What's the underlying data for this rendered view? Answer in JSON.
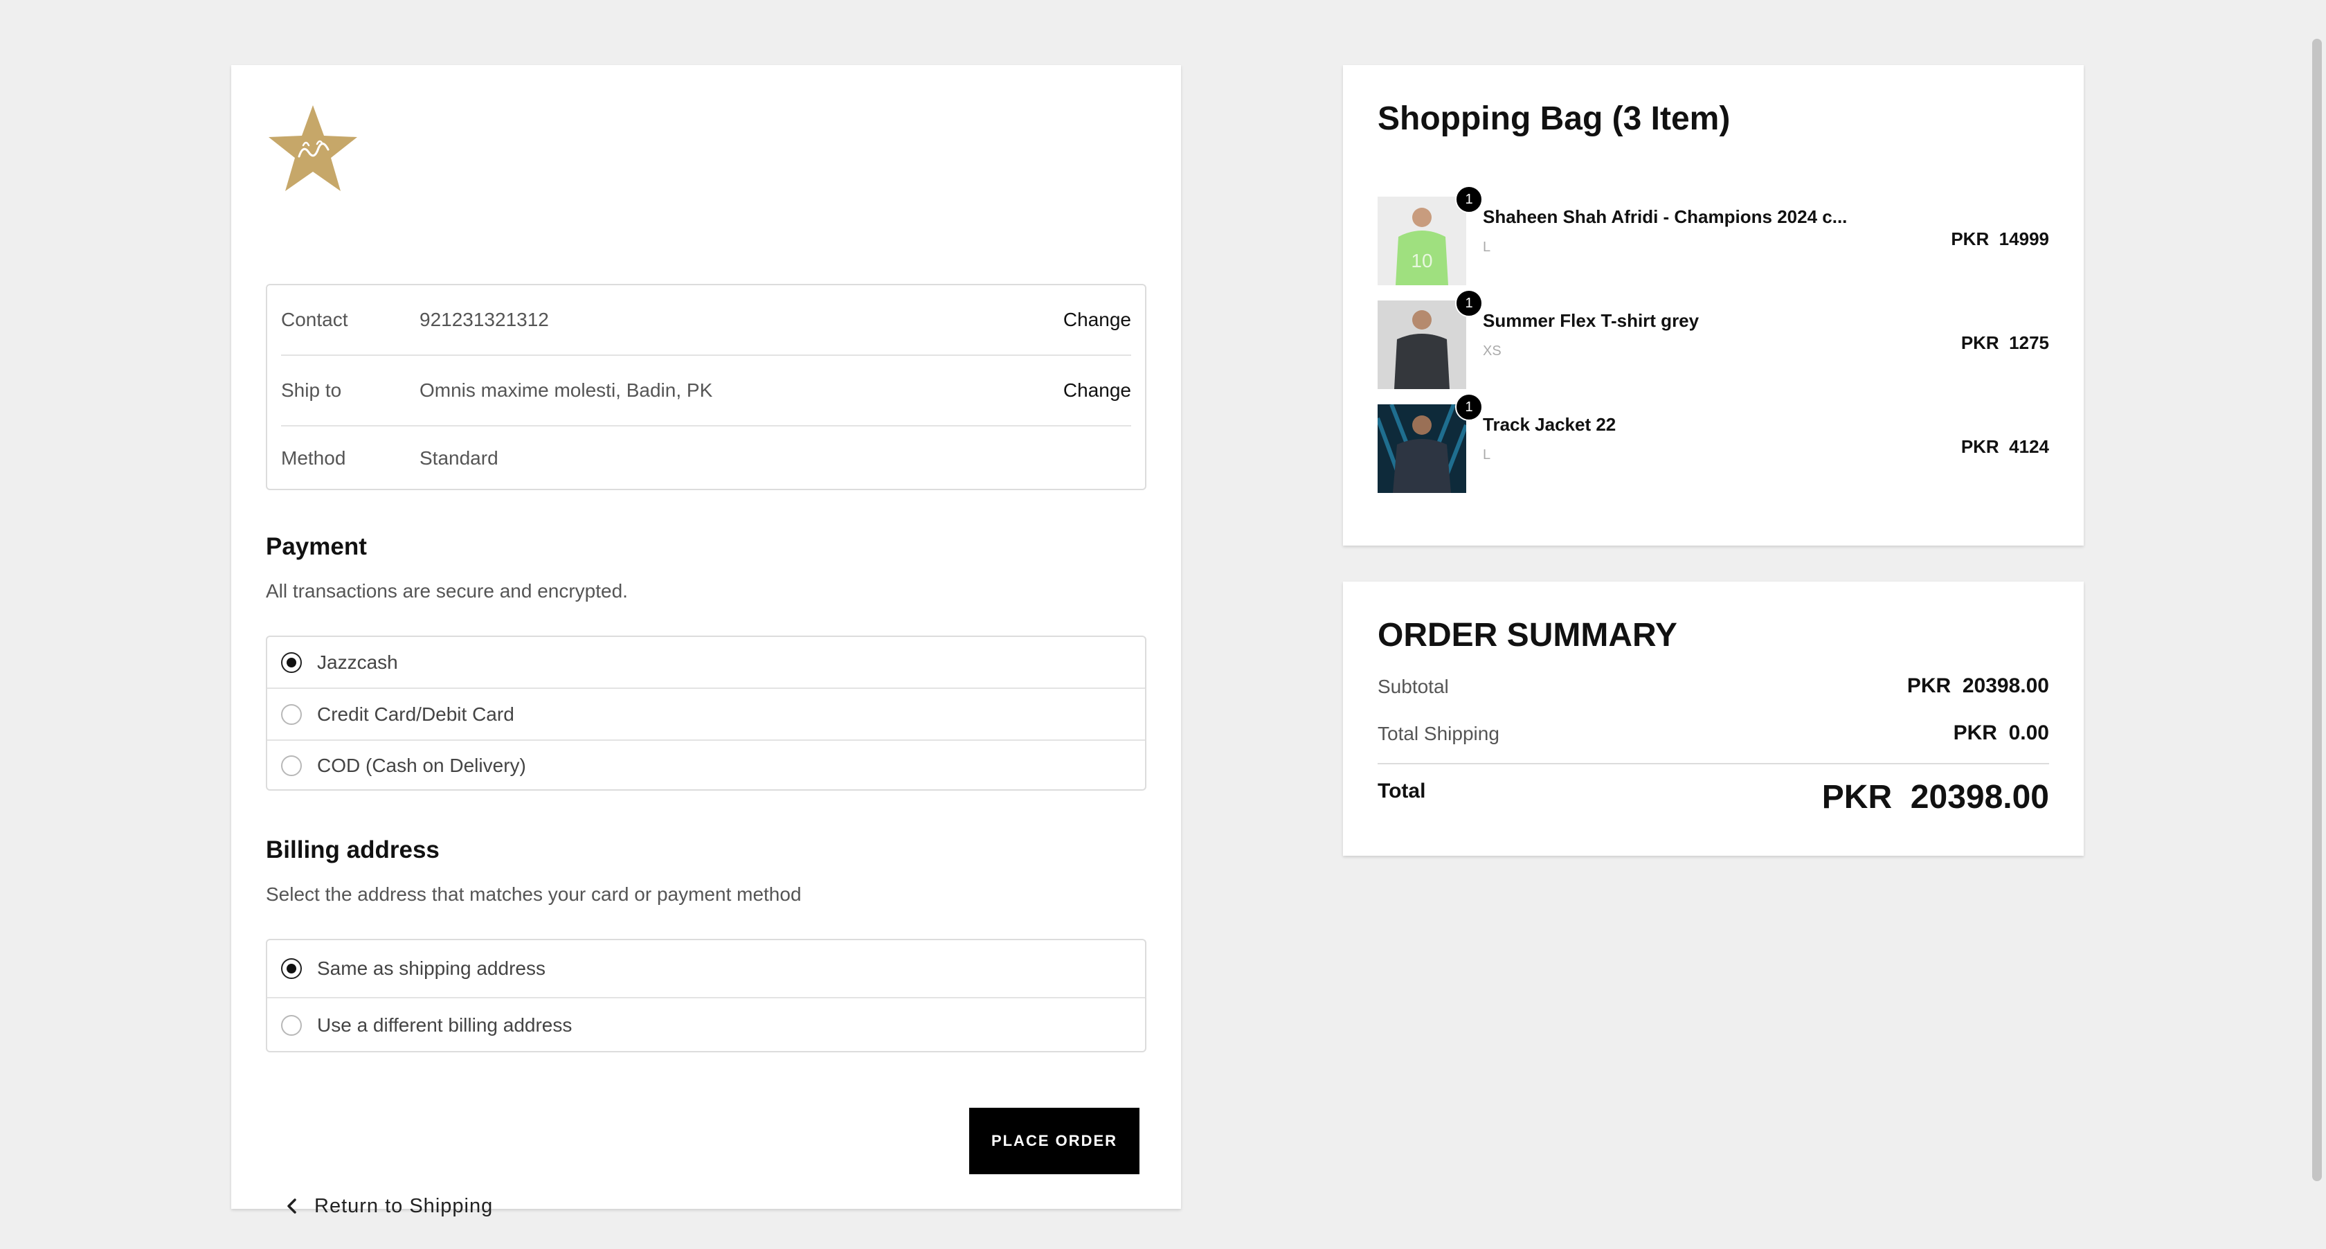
{
  "brand": {
    "logo_icon": "star-crest-logo",
    "logo_color": "#c6a769"
  },
  "contact": {
    "rows": [
      {
        "label": "Contact",
        "value": "921231321312",
        "action": "Change"
      },
      {
        "label": "Ship to",
        "value": "Omnis maxime molesti, Badin, PK",
        "action": "Change"
      },
      {
        "label": "Method",
        "value": "Standard"
      }
    ]
  },
  "payment": {
    "title": "Payment",
    "subtitle": "All transactions are secure and encrypted.",
    "options": [
      {
        "label": "Jazzcash",
        "selected": true
      },
      {
        "label": "Credit Card/Debit Card",
        "selected": false
      },
      {
        "label": "COD (Cash on Delivery)",
        "selected": false
      }
    ]
  },
  "billing": {
    "title": "Billing address",
    "subtitle": "Select the address that matches your card or payment method",
    "options": [
      {
        "label": "Same as shipping address",
        "selected": true
      },
      {
        "label": "Use a different billing address",
        "selected": false
      }
    ]
  },
  "actions": {
    "return_label": "Return to Shipping",
    "place_order_label": "PLACE ORDER"
  },
  "bag": {
    "title": "Shopping Bag (3 Item)",
    "items": [
      {
        "qty": "1",
        "name": "Shaheen Shah Afridi - Champions 2024 c...",
        "size": "L",
        "price": "PKR  14999"
      },
      {
        "qty": "1",
        "name": "Summer Flex T-shirt grey",
        "size": "XS",
        "price": "PKR  1275"
      },
      {
        "qty": "1",
        "name": "Track Jacket 22",
        "size": "L",
        "price": "PKR  4124"
      }
    ]
  },
  "summary": {
    "title": "ORDER SUMMARY",
    "subtotal_label": "Subtotal",
    "subtotal_value": "PKR  20398.00",
    "shipping_label": "Total Shipping",
    "shipping_value": "PKR  0.00",
    "total_label": "Total",
    "total_value": "PKR  20398.00"
  }
}
